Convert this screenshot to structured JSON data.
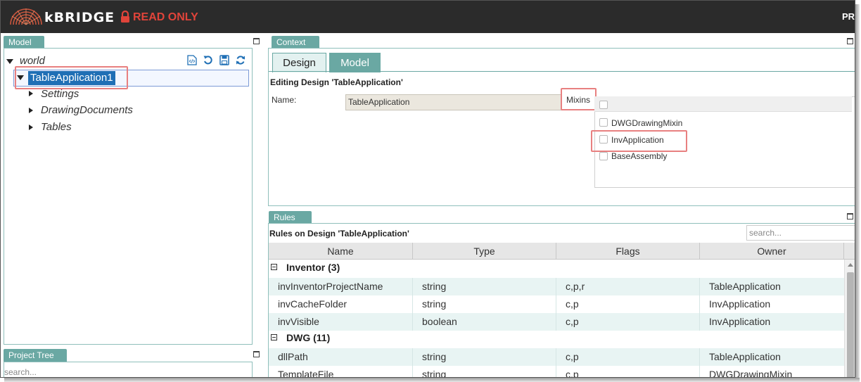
{
  "app": {
    "brand": "kBRIDGE",
    "mode": "READ ONLY",
    "right_text": "PR"
  },
  "model_panel": {
    "title": "Model",
    "tree": [
      {
        "label": "world"
      },
      {
        "label": "TableApplication1"
      },
      {
        "label": "Settings"
      },
      {
        "label": "DrawingDocuments"
      },
      {
        "label": "Tables"
      }
    ]
  },
  "project_panel": {
    "title": "Project Tree",
    "search_placeholder": "search..."
  },
  "context_panel": {
    "title": "Context",
    "tabs": [
      {
        "label": "Design"
      },
      {
        "label": "Model"
      }
    ],
    "editing_title": "Editing Design 'TableApplication'",
    "name_label": "Name:",
    "name_value": "TableApplication",
    "mixins_label": "Mixins",
    "mixins": [
      {
        "label": "DWGDrawingMixin"
      },
      {
        "label": "InvApplication"
      },
      {
        "label": "BaseAssembly"
      }
    ]
  },
  "rules_panel": {
    "title": "Rules",
    "subtitle": "Rules on Design 'TableApplication'",
    "search_placeholder": "search...",
    "columns": [
      "Name",
      "Type",
      "Flags",
      "Owner"
    ],
    "groups": [
      {
        "label": "Inventor (3)",
        "rows": [
          {
            "name": "invInventorProjectName",
            "type": "string",
            "flags": "c,p,r",
            "owner": "TableApplication"
          },
          {
            "name": "invCacheFolder",
            "type": "string",
            "flags": "c,p",
            "owner": "InvApplication"
          },
          {
            "name": "invVisible",
            "type": "boolean",
            "flags": "c,p",
            "owner": "InvApplication"
          }
        ]
      },
      {
        "label": "DWG (11)",
        "rows": [
          {
            "name": "dllPath",
            "type": "string",
            "flags": "c,p",
            "owner": "TableApplication"
          },
          {
            "name": "TemplateFile",
            "type": "string",
            "flags": "c,p",
            "owner": "DWGDrawingMixin"
          }
        ]
      }
    ]
  },
  "colors": {
    "accent": "#6aa8a3",
    "readonly": "#e0443a",
    "selection": "#1f6fb5",
    "highlight": "#e88080"
  }
}
